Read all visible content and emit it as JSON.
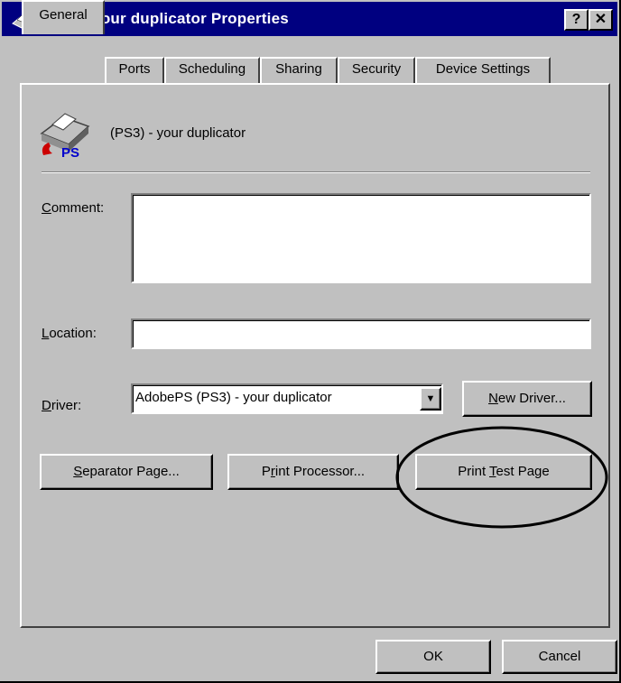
{
  "window": {
    "title": "(PS3) - your duplicator Properties",
    "help_button": "?",
    "close_button": "✕"
  },
  "tabs": [
    {
      "label": "General",
      "active": true
    },
    {
      "label": "Ports",
      "active": false
    },
    {
      "label": "Scheduling",
      "active": false
    },
    {
      "label": "Sharing",
      "active": false
    },
    {
      "label": "Security",
      "active": false
    },
    {
      "label": "Device Settings",
      "active": false
    }
  ],
  "printer": {
    "icon": "postscript-printer-icon",
    "icon_badge": "PS",
    "name": "(PS3) - your duplicator"
  },
  "comment": {
    "label_key": "C",
    "label_rest": "omment:",
    "value": ""
  },
  "location": {
    "label_key": "L",
    "label_rest": "ocation:",
    "value": ""
  },
  "driver": {
    "label_key": "D",
    "label_rest": "river:",
    "selected": "AdobePS (PS3) - your duplicator",
    "dropdown_arrow": "▼",
    "new_driver_key": "N",
    "new_driver_rest": "ew Driver..."
  },
  "buttons": {
    "separator_key": "S",
    "separator_rest": "eparator Page...",
    "processor_pre": "P",
    "processor_key": "r",
    "processor_rest": "int Processor...",
    "test_pre": "Print ",
    "test_key": "T",
    "test_rest": "est Page",
    "ok": "OK",
    "cancel": "Cancel"
  },
  "annotation_color": "#000000"
}
